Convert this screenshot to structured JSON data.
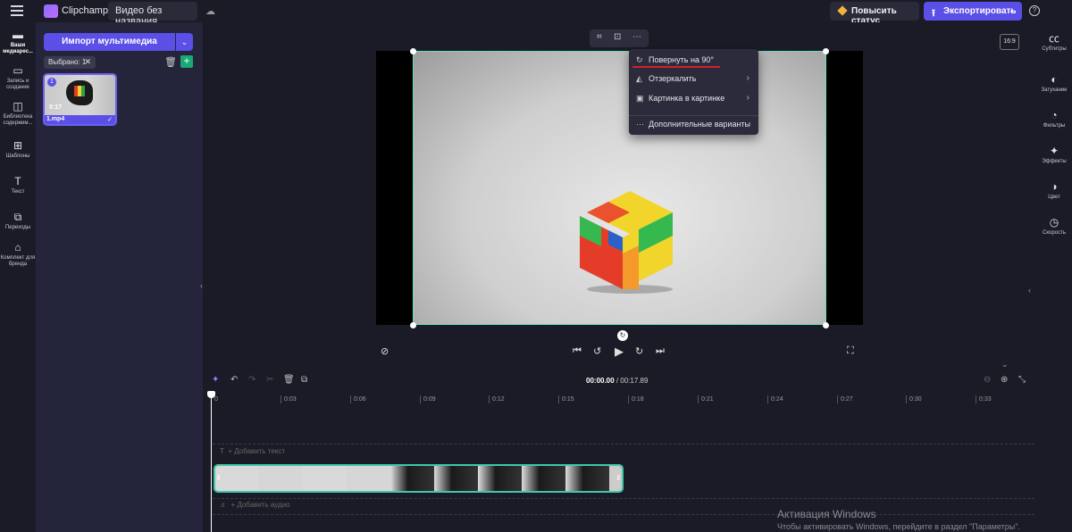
{
  "topbar": {
    "app_name": "Clipchamp",
    "project_title": "Видео без названия",
    "upgrade_label": "Повысить статус",
    "export_label": "Экспортировать"
  },
  "leftnav": {
    "items": [
      {
        "label": "Ваши медиарес...",
        "icon": "folder-icon"
      },
      {
        "label": "Запись и создание",
        "icon": "camera-icon"
      },
      {
        "label": "Библиотека содержим...",
        "icon": "library-icon"
      },
      {
        "label": "Шаблоны",
        "icon": "templates-icon"
      },
      {
        "label": "Текст",
        "icon": "text-icon"
      },
      {
        "label": "Переходы",
        "icon": "transitions-icon"
      },
      {
        "label": "Комплект для бренда",
        "icon": "brand-icon"
      }
    ]
  },
  "media": {
    "import_label": "Импорт мультимедиа",
    "selected_chip": "Выбрано: 1",
    "clip": {
      "index": "1",
      "duration": "0:17",
      "filename": "1.mp4"
    }
  },
  "preview": {
    "aspect_ratio": "16:9",
    "menu": {
      "items": [
        "Повернуть на 90°",
        "Отзеркалить",
        "Картинка в картинке",
        "Дополнительные варианты"
      ]
    }
  },
  "rightnav": {
    "items": [
      {
        "label": "Субтитры",
        "icon": "captions-icon"
      },
      {
        "label": "Затухание",
        "icon": "fade-icon"
      },
      {
        "label": "Фильтры",
        "icon": "filters-icon"
      },
      {
        "label": "Эффекты",
        "icon": "effects-icon"
      },
      {
        "label": "Цвет",
        "icon": "color-icon"
      },
      {
        "label": "Скорость",
        "icon": "speed-icon"
      }
    ]
  },
  "timeline": {
    "current_time": "00:00.00",
    "total_time": "/ 00:17.89",
    "ticks": [
      "0",
      "0:03",
      "0:06",
      "0:09",
      "0:12",
      "0:15",
      "0:18",
      "0:21",
      "0:24",
      "0:27",
      "0:30",
      "0:33"
    ],
    "add_text": "+ Добавить текст",
    "add_audio": "+ Добавить аудио"
  },
  "watermark": {
    "title": "Активация Windows",
    "subtitle": "Чтобы активировать Windows, перейдите в раздел \"Параметры\"."
  },
  "colors": {
    "accent": "#5a4fe6",
    "selection": "#40c9a8",
    "underline": "#d3202a"
  }
}
